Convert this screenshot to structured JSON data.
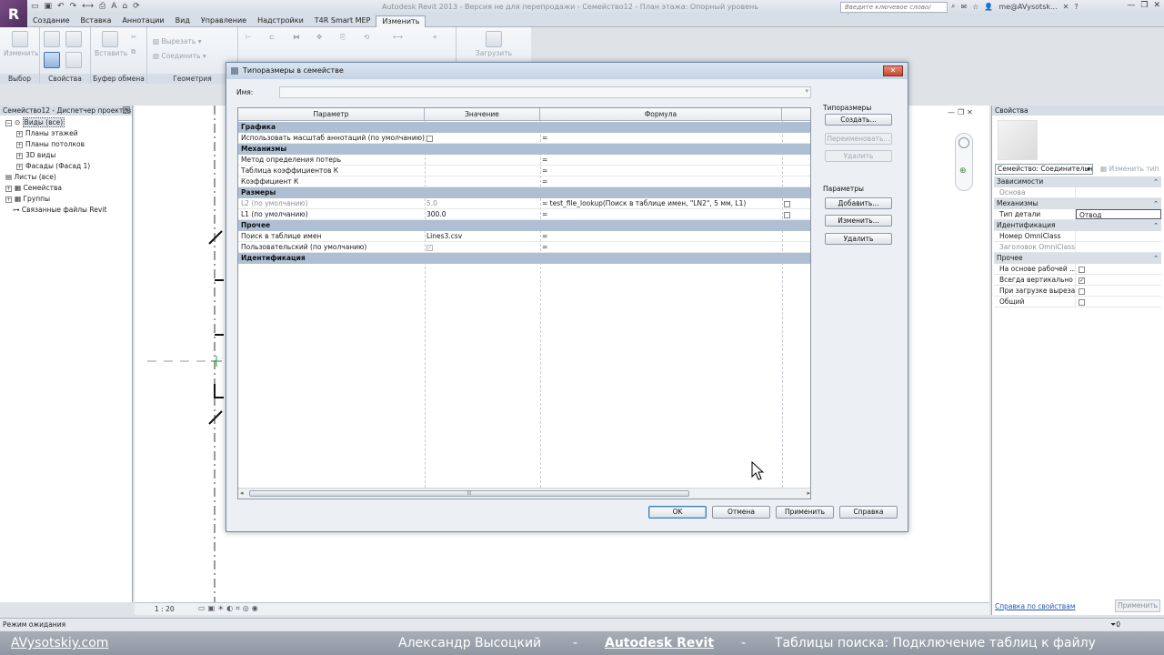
{
  "app": {
    "logo": "R",
    "title": "Autodesk Revit 2013 - Версия не для перепродажи -     Семейство12 - План этажа: Опорный уровень",
    "search_placeholder": "Введите ключевое слово/фразу",
    "user": "me@AVysotsk...",
    "qat_icons": [
      "open-icon",
      "save-icon",
      "undo-icon",
      "redo-icon",
      "measure-icon",
      "print-icon",
      "text-icon",
      "3d-view-icon",
      "sync-icon"
    ]
  },
  "tabs": [
    {
      "label": "Создание"
    },
    {
      "label": "Вставка"
    },
    {
      "label": "Аннотации"
    },
    {
      "label": "Вид"
    },
    {
      "label": "Управление"
    },
    {
      "label": "Надстройки"
    },
    {
      "label": "T4R Smart MEP"
    },
    {
      "label": "Изменить",
      "active": true
    }
  ],
  "ribbon": {
    "panels": [
      {
        "label": "Выбор",
        "buttons": [
          "Изменить"
        ]
      },
      {
        "label": "Свойства",
        "buttons": []
      },
      {
        "label": "Буфер обмена",
        "buttons": [
          "Вставить",
          "Вырезать",
          "Соединить"
        ]
      },
      {
        "label": "Геометрия",
        "buttons": []
      }
    ],
    "load_label": "Загрузить"
  },
  "browser": {
    "title": "Семейство12 - Диспетчер проектов",
    "nodes": [
      {
        "label": "Виды (все)",
        "toggle": "−"
      },
      {
        "label": "Планы этажей",
        "toggle": "+"
      },
      {
        "label": "Планы потолков",
        "toggle": "+"
      },
      {
        "label": "3D виды",
        "toggle": "+"
      },
      {
        "label": "Фасады (Фасад 1)",
        "toggle": "+"
      },
      {
        "label": "Листы (все)",
        "toggle": ""
      },
      {
        "label": "Семейства",
        "toggle": "+"
      },
      {
        "label": "Группы",
        "toggle": "+"
      },
      {
        "label": "Связанные файлы Revit",
        "toggle": ""
      }
    ]
  },
  "view": {
    "scale": "1 : 20"
  },
  "dialog": {
    "title": "Типоразмеры в семействе",
    "name_label": "Имя:",
    "columns": [
      "Параметр",
      "Значение",
      "Формула"
    ],
    "groups": [
      {
        "label": "Графика",
        "rows": [
          {
            "param": "Использовать масштаб аннотаций (по умолчанию)",
            "value": "",
            "checkbox": true,
            "checked": false,
            "formula": "="
          }
        ]
      },
      {
        "label": "Механизмы",
        "rows": [
          {
            "param": "Метод определения потерь",
            "value": "",
            "formula": "="
          },
          {
            "param": "Таблица коэффициентов К",
            "value": "",
            "formula": "="
          },
          {
            "param": "Коэффициент К",
            "value": "",
            "formula": "="
          }
        ]
      },
      {
        "label": "Размеры",
        "rows": [
          {
            "param": "L2 (по умолчанию)",
            "value": "5.0",
            "formula": "= test_file_lookup(Поиск в таблице имен, \"LN2\", 5 мм, L1)",
            "dim": true,
            "lock": true
          },
          {
            "param": "L1 (по умолчанию)",
            "value": "300.0",
            "formula": "=",
            "lock": true
          }
        ]
      },
      {
        "label": "Прочее",
        "rows": [
          {
            "param": "Поиск в таблице имен",
            "value": "Lines3.csv",
            "formula": "="
          },
          {
            "param": "Пользовательский (по умолчанию)",
            "value": "",
            "checkbox": true,
            "checked": true,
            "formula": "="
          }
        ]
      },
      {
        "label": "Идентификация",
        "rows": []
      }
    ],
    "types_section": "Типоразмеры",
    "btn_create": "Создать...",
    "btn_rename": "Переименовать...",
    "btn_delete_type": "Удалить",
    "params_section": "Параметры",
    "btn_add": "Добавить...",
    "btn_modify": "Изменить...",
    "btn_delete_param": "Удалить",
    "btn_ok": "OK",
    "btn_cancel": "Отмена",
    "btn_apply": "Применить",
    "btn_help": "Справка"
  },
  "properties": {
    "title": "Свойства",
    "type_selector": "Семейство: Соединительн",
    "edit_type": "Изменить тип",
    "groups": [
      {
        "label": "Зависимости",
        "rows": [
          {
            "name": "Основа",
            "value": "",
            "dim": true
          }
        ]
      },
      {
        "label": "Механизмы",
        "rows": [
          {
            "name": "Тип детали",
            "value": "Отвод",
            "boxed": true
          }
        ]
      },
      {
        "label": "Идентификация",
        "rows": [
          {
            "name": "Номер OmniClass",
            "value": ""
          },
          {
            "name": "Заголовок OmniClass",
            "value": "",
            "dim": true
          }
        ]
      },
      {
        "label": "Прочее",
        "rows": [
          {
            "name": "На основе рабочей ...",
            "checkbox": true,
            "checked": false
          },
          {
            "name": "Всегда вертикально",
            "checkbox": true,
            "checked": true
          },
          {
            "name": "При загрузке выреза...",
            "checkbox": true,
            "checked": false
          },
          {
            "name": "Общий",
            "checkbox": true,
            "checked": false
          }
        ]
      }
    ],
    "help_link": "Справка по свойствам",
    "apply": "Применить"
  },
  "status": {
    "text": "Режим ожидания",
    "filter": "0"
  },
  "caption": {
    "site": "AVysotskiy.com",
    "author": "Александр Высоцкий",
    "sep1": "-",
    "product": "Autodesk Revit",
    "sep2": "-",
    "topic": "Таблицы поиска: Подключение таблиц к файлу"
  }
}
